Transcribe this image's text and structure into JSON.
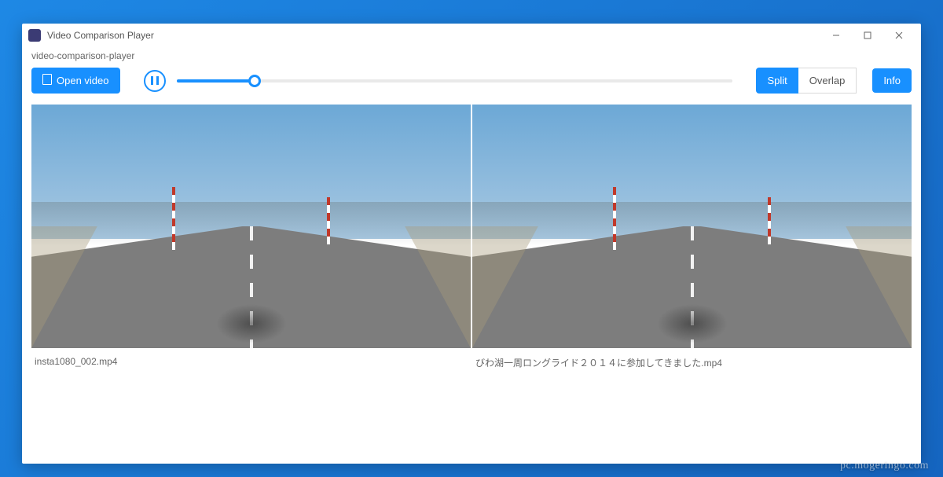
{
  "window": {
    "title": "Video Comparison Player",
    "subtitle": "video-comparison-player"
  },
  "toolbar": {
    "open_label": "Open video",
    "split_label": "Split",
    "overlap_label": "Overlap",
    "info_label": "Info",
    "active_mode": "Split"
  },
  "playback": {
    "state": "paused",
    "progress_percent": 14
  },
  "videos": {
    "left": {
      "filename": "insta1080_002.mp4"
    },
    "right": {
      "filename": "びわ湖一周ロングライド２０１４に参加してきました.mp4"
    }
  },
  "watermark": "pc.mogeringo.com",
  "colors": {
    "accent": "#1890ff",
    "text_muted": "#666"
  }
}
